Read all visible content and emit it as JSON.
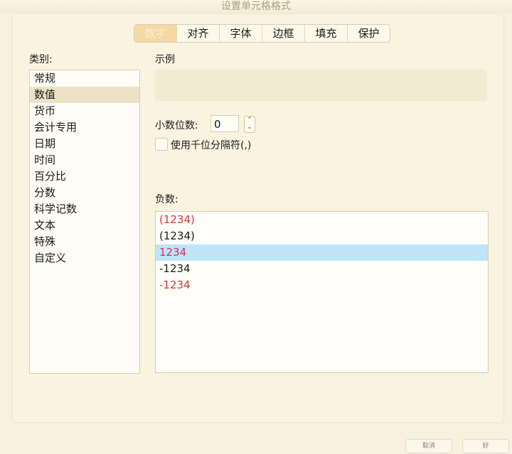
{
  "window": {
    "title": "设置单元格格式"
  },
  "tabs": [
    {
      "label": "数字",
      "active": true
    },
    {
      "label": "对齐"
    },
    {
      "label": "字体"
    },
    {
      "label": "边框"
    },
    {
      "label": "填充"
    },
    {
      "label": "保护"
    }
  ],
  "category": {
    "label": "类别:",
    "items": [
      "常规",
      "数值",
      "货币",
      "会计专用",
      "日期",
      "时间",
      "百分比",
      "分数",
      "科学记数",
      "文本",
      "特殊",
      "自定义"
    ],
    "selected": "数值"
  },
  "sample": {
    "label": "示例"
  },
  "decimal": {
    "label": "小数位数:",
    "value": "0"
  },
  "thousands": {
    "label": "使用千位分隔符(,)",
    "checked": false
  },
  "negative": {
    "label": "负数:",
    "items": [
      {
        "text": "(1234)",
        "color": "#d0392b"
      },
      {
        "text": "(1234)",
        "color": "#1a1a1a"
      },
      {
        "text": "1234",
        "color": "#d0305e"
      },
      {
        "text": "-1234",
        "color": "#1a1a1a"
      },
      {
        "text": "-1234",
        "color": "#d0392b"
      }
    ],
    "selected_index": 2,
    "selected_bg": "#bfe3f7"
  },
  "buttons": {
    "cancel": "取消",
    "ok": "好"
  },
  "colors": {
    "dialog_bg": "#f9f3df",
    "active_tab": "#f4d9a5"
  }
}
